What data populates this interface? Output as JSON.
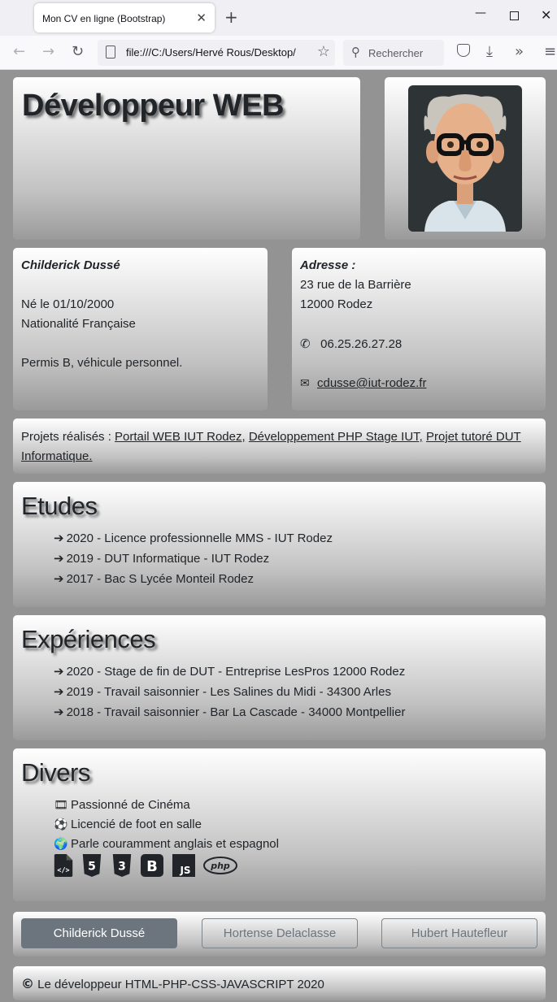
{
  "browser": {
    "tab_title": "Mon CV en ligne (Bootstrap)",
    "url": "file:///C:/Users/Hervé Rous/Desktop/",
    "search_placeholder": "Rechercher"
  },
  "header": {
    "title": "Développeur WEB"
  },
  "identity": {
    "name": "Childerick Dussé",
    "birth": "Né le 01/10/2000",
    "nationality": "Nationalité Française",
    "license": "Permis B, véhicule personnel."
  },
  "contact": {
    "label": "Adresse :",
    "street": "23 rue de la Barrière",
    "city": "12000 Rodez",
    "phone": "06.25.26.27.28",
    "email": "cdusse@iut-rodez.fr"
  },
  "projects": {
    "label": "Projets réalisés :",
    "links": [
      "Portail WEB IUT Rodez,",
      "Développement PHP Stage IUT,",
      "Projet tutoré DUT Informatique."
    ]
  },
  "etudes": {
    "title": "Etudes",
    "items": [
      "2020 - Licence professionnelle MMS - IUT Rodez",
      "2019 - DUT Informatique - IUT Rodez",
      "2017 - Bac S Lycée Monteil Rodez"
    ]
  },
  "experiences": {
    "title": "Expériences",
    "items": [
      "2020 - Stage de fin de DUT - Entreprise LesPros 12000 Rodez",
      "2019 - Travail saisonnier - Les Salines du Midi - 34300 Arles",
      "2018 - Travail saisonnier - Bar La Cascade - 34000 Montpellier"
    ]
  },
  "divers": {
    "title": "Divers",
    "items": [
      {
        "icon": "film-icon",
        "text": "Passionné de Cinéma"
      },
      {
        "icon": "soccer-ball-icon",
        "text": "Licencié de foot en salle"
      },
      {
        "icon": "globe-icon",
        "text": "Parle couramment anglais et espagnol"
      }
    ],
    "tech": {
      "html5": "5",
      "css3": "3",
      "bootstrap": "B",
      "js": "JS",
      "php": "php"
    }
  },
  "people": {
    "buttons": [
      "Childerick Dussé",
      "Hortense Delaclasse",
      "Hubert Hautefleur"
    ]
  },
  "footer": {
    "text": "Le développeur HTML-PHP-CSS-JAVASCRIPT 2020"
  }
}
